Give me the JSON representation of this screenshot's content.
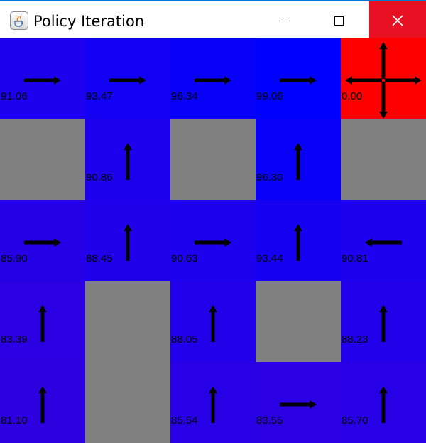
{
  "window": {
    "title": "Policy Iteration",
    "icon": "java-cup-icon",
    "close_color": "#e81123"
  },
  "grid": {
    "rows": 5,
    "cols": 5,
    "cells": [
      [
        {
          "type": "state",
          "value": "91.06",
          "policy": "right",
          "color": "#1c00ee"
        },
        {
          "type": "state",
          "value": "93.47",
          "policy": "right",
          "color": "#1100f4"
        },
        {
          "type": "state",
          "value": "96.34",
          "policy": "right",
          "color": "#0900f8"
        },
        {
          "type": "state",
          "value": "99.06",
          "policy": "right",
          "color": "#0000ff"
        },
        {
          "type": "terminal",
          "value": "0.00",
          "policy": "all",
          "color": "#ff0000"
        }
      ],
      [
        {
          "type": "wall",
          "color": "#808080"
        },
        {
          "type": "state",
          "value": "90.86",
          "policy": "up",
          "color": "#1c00ee"
        },
        {
          "type": "wall",
          "color": "#808080"
        },
        {
          "type": "state",
          "value": "96.30",
          "policy": "up",
          "color": "#0900f8"
        },
        {
          "type": "wall",
          "color": "#808080"
        }
      ],
      [
        {
          "type": "state",
          "value": "85.90",
          "policy": "right",
          "color": "#2500e6"
        },
        {
          "type": "state",
          "value": "88.45",
          "policy": "up",
          "color": "#2000eb"
        },
        {
          "type": "state",
          "value": "90.63",
          "policy": "right",
          "color": "#1c00ee"
        },
        {
          "type": "state",
          "value": "93.44",
          "policy": "up",
          "color": "#1600f2"
        },
        {
          "type": "state",
          "value": "90.81",
          "policy": "left",
          "color": "#1c00ee"
        }
      ],
      [
        {
          "type": "state",
          "value": "83.39",
          "policy": "up",
          "color": "#2a00e2"
        },
        {
          "type": "wall",
          "color": "#808080"
        },
        {
          "type": "state",
          "value": "88.05",
          "policy": "up",
          "color": "#2200ea"
        },
        {
          "type": "wall",
          "color": "#808080"
        },
        {
          "type": "state",
          "value": "88.23",
          "policy": "up",
          "color": "#2200ea"
        }
      ],
      [
        {
          "type": "state",
          "value": "81.10",
          "policy": "up",
          "color": "#2d00df"
        },
        {
          "type": "wall",
          "color": "#808080"
        },
        {
          "type": "state",
          "value": "85.54",
          "policy": "up",
          "color": "#2700e5"
        },
        {
          "type": "state",
          "value": "83.55",
          "policy": "right",
          "color": "#2a00e2"
        },
        {
          "type": "state",
          "value": "85.70",
          "policy": "up",
          "color": "#2700e5"
        }
      ]
    ]
  }
}
